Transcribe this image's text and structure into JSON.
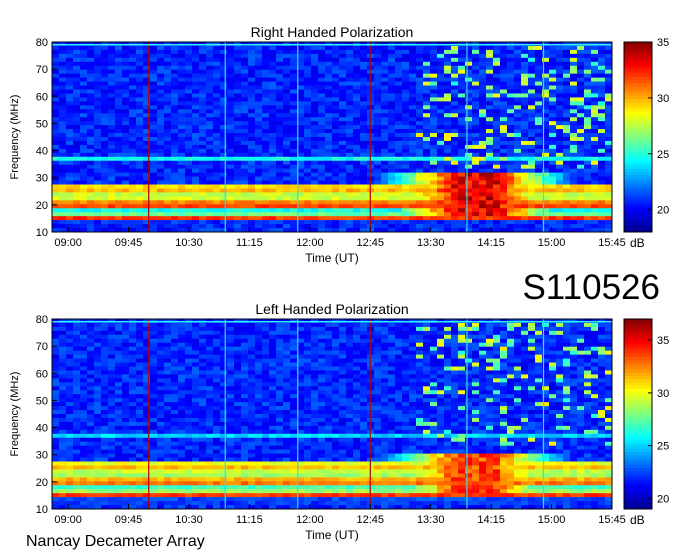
{
  "title_id": "S110526",
  "footer": "Nancay Decameter Array",
  "colors": {
    "jet": [
      "#00008f",
      "#0000ff",
      "#0080ff",
      "#00ffff",
      "#80ff80",
      "#ffff00",
      "#ff8000",
      "#ff0000",
      "#800000"
    ],
    "background": "#ffffff"
  },
  "chart_data": [
    {
      "type": "heatmap",
      "title": "Right Handed Polarization",
      "xlabel": "Time (UT)",
      "ylabel": "Frequency (MHz)",
      "x_ticks": [
        "09:00",
        "09:45",
        "10:30",
        "11:15",
        "12:00",
        "12:45",
        "13:30",
        "14:15",
        "15:00",
        "15:45"
      ],
      "y_ticks": [
        "10",
        "20",
        "30",
        "40",
        "50",
        "60",
        "70",
        "80"
      ],
      "xlim_hours": [
        8.8,
        15.75
      ],
      "ylim": [
        10,
        80
      ],
      "colorbar": {
        "ticks": [
          "20",
          "25",
          "30",
          "35"
        ],
        "range": [
          18,
          35
        ],
        "unit": "dB"
      },
      "bands": [
        {
          "freq": 13,
          "level": 0.2
        },
        {
          "freq": 15,
          "level": 0.8
        },
        {
          "freq": 17,
          "level": 0.5
        },
        {
          "freq": 20,
          "level": 0.85
        },
        {
          "freq": 22,
          "level": 0.6
        },
        {
          "freq": 25,
          "level": 0.7
        },
        {
          "freq": 27,
          "level": 0.65
        },
        {
          "freq": 37,
          "level": 0.35
        }
      ],
      "burst": {
        "t_start_hours": 12.6,
        "t_end_hours": 15.5,
        "f_low": 16,
        "f_high": 32,
        "level": 0.95
      }
    },
    {
      "type": "heatmap",
      "title": "Left Handed Polarization",
      "xlabel": "Time (UT)",
      "ylabel": "Frequency (MHz)",
      "x_ticks": [
        "09:00",
        "09:45",
        "10:30",
        "11:15",
        "12:00",
        "12:45",
        "13:30",
        "14:15",
        "15:00",
        "15:45"
      ],
      "y_ticks": [
        "10",
        "20",
        "30",
        "40",
        "50",
        "60",
        "70",
        "80"
      ],
      "xlim_hours": [
        8.8,
        15.75
      ],
      "ylim": [
        10,
        80
      ],
      "colorbar": {
        "ticks": [
          "20",
          "25",
          "30",
          "35"
        ],
        "range": [
          19,
          37
        ],
        "unit": "dB"
      },
      "bands": [
        {
          "freq": 13,
          "level": 0.25
        },
        {
          "freq": 15,
          "level": 0.8
        },
        {
          "freq": 17,
          "level": 0.55
        },
        {
          "freq": 20,
          "level": 0.8
        },
        {
          "freq": 22,
          "level": 0.55
        },
        {
          "freq": 25,
          "level": 0.7
        },
        {
          "freq": 27,
          "level": 0.6
        },
        {
          "freq": 37,
          "level": 0.3
        }
      ],
      "burst": {
        "t_start_hours": 12.6,
        "t_end_hours": 15.5,
        "f_low": 16,
        "f_high": 30,
        "level": 0.85
      }
    }
  ]
}
